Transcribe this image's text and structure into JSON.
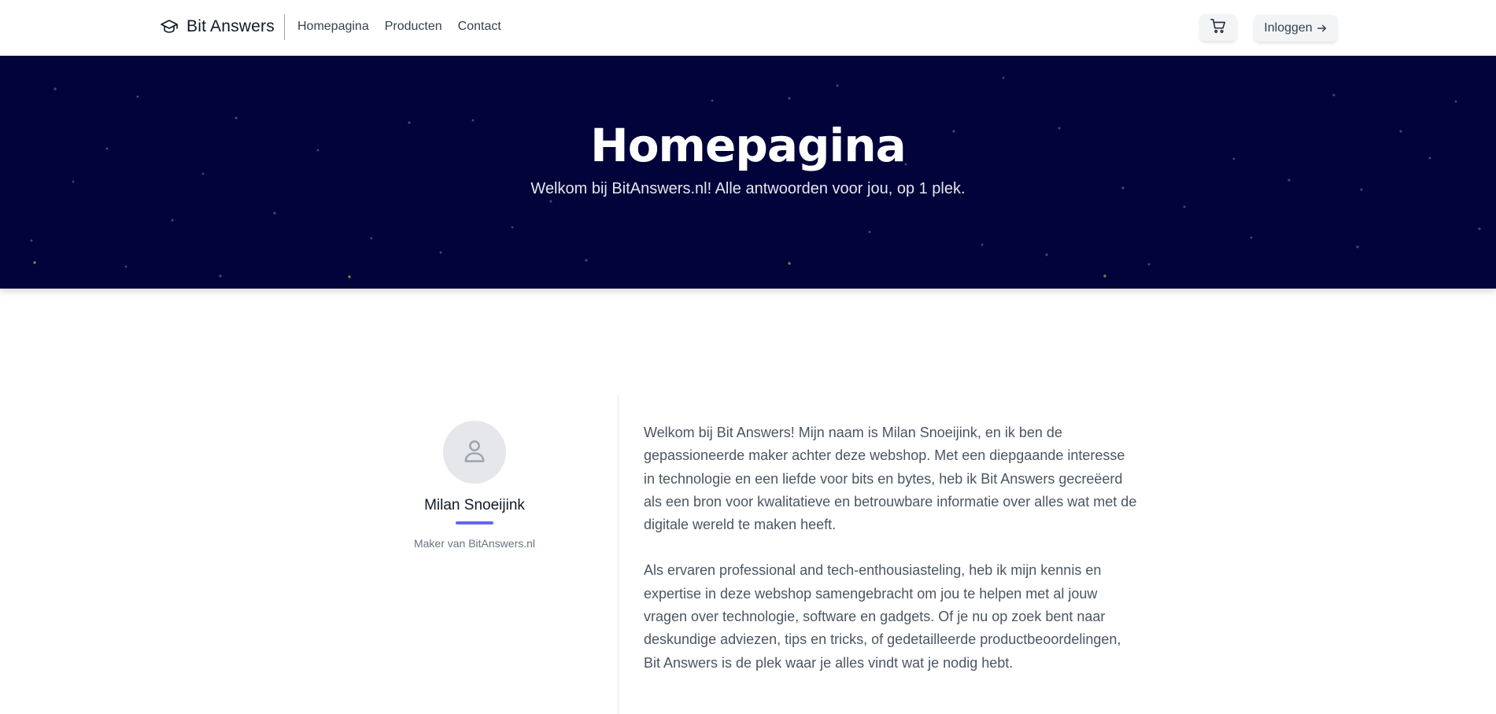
{
  "nav": {
    "brand": "Bit Answers",
    "brand_icon": "graduation-cap-icon",
    "links": [
      "Homepagina",
      "Producten",
      "Contact"
    ],
    "cart_icon": "shopping-cart-icon",
    "login_label": "Inloggen",
    "login_icon": "arrow-right-icon"
  },
  "hero": {
    "title": "Homepagina",
    "subtitle": "Welkom bij BitAnswers.nl! Alle antwoorden voor jou, op 1 plek.",
    "background_color": "#01033a"
  },
  "profile": {
    "avatar_icon": "user-icon",
    "name": "Milan Snoeijink",
    "role": "Maker van BitAnswers.nl",
    "accent_color": "#6366f1"
  },
  "bio": {
    "paragraphs": [
      "Welkom bij Bit Answers! Mijn naam is Milan Snoeijink, en ik ben de gepassioneerde maker achter deze webshop. Met een diepgaande interesse in technologie en een liefde voor bits en bytes, heb ik Bit Answers gecreëerd als een bron voor kwalitatieve en betrouwbare informatie over alles wat met de digitale wereld te maken heeft.",
      "Als ervaren professional and tech-enthousiasteling, heb ik mijn kennis en expertise in deze webshop samengebracht om jou te helpen met al jouw vragen over technologie, software en gadgets. Of je nu op zoek bent naar deskundige adviezen, tips en tricks, of gedetailleerde productbeoordelingen, Bit Answers is de plek waar je alles vindt wat je nodig hebt."
    ]
  }
}
